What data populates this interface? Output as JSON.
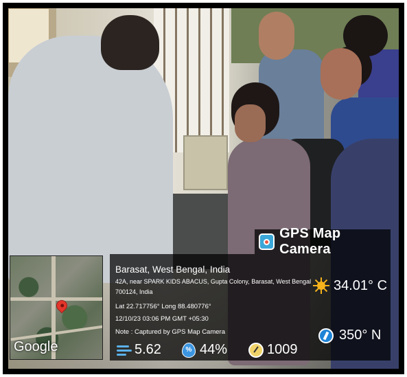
{
  "overlay": {
    "brand": "GPS Map Camera",
    "location_title": "Barasat, West Bengal, India",
    "address_line1": "42A, near SPARK KIDS ABACUS, Gupta Colony, Barasat, West Bengal",
    "address_line2": "700124, India",
    "latlong": "Lat 22.717756° Long 88.480776°",
    "datetime": "12/10/23 03:06 PM GMT +05:30",
    "note": "Note : Captured by GPS Map Camera",
    "temperature": "34.01° C",
    "heading": "350° N",
    "wind": "5.62",
    "humidity": "44%",
    "pressure": "1009",
    "map_logo": "Google"
  },
  "icons": {
    "brand": "gps-map-camera-logo",
    "weather": "sun-icon",
    "compass": "compass-icon",
    "wind": "wind-icon",
    "humidity": "humidity-icon",
    "pressure": "pressure-gauge-icon",
    "map_marker": "map-pin-icon"
  },
  "colors": {
    "overlay_bg": "#000000",
    "text": "#ffffff",
    "sun": "#f6b31b",
    "pin": "#e4362b"
  }
}
